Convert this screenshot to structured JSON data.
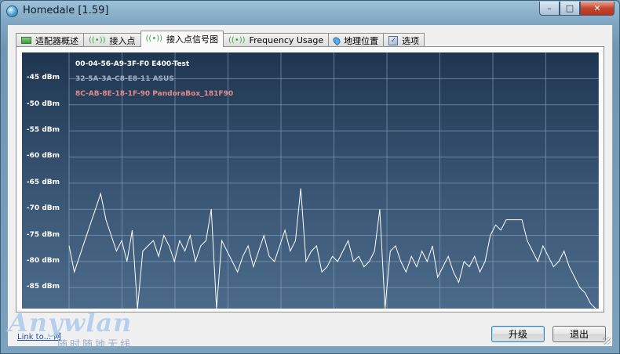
{
  "window": {
    "title": "Homedale [1.59]",
    "buttons": {
      "minimize": "–",
      "maximize": "□",
      "close": "✕"
    }
  },
  "tabs": [
    {
      "label": "适配器概述",
      "icon": "adapter-flag-icon"
    },
    {
      "label": "接入点",
      "icon": "wifi-signal-icon"
    },
    {
      "label": "接入点信号图",
      "icon": "wifi-signal-icon",
      "active": true
    },
    {
      "label": "Frequency Usage",
      "icon": "wifi-signal-icon"
    },
    {
      "label": "地理位置",
      "icon": "map-pin-icon"
    },
    {
      "label": "选项",
      "icon": "options-icon"
    }
  ],
  "legend": [
    {
      "text": "00-04-56-A9-3F-F0 E400-Test",
      "color": "#ffffff"
    },
    {
      "text": "32-5A-3A-C8-E8-11 ASUS",
      "color": "#9fb0c8"
    },
    {
      "text": "8C-AB-8E-18-1F-90 PandoraBox_181F90",
      "color": "#e08b8b"
    }
  ],
  "chart_data": {
    "type": "line",
    "yunit": "dBm",
    "ylim": [
      -89,
      -40
    ],
    "ytick_labels": [
      "-45 dBm",
      "-50 dBm",
      "-55 dBm",
      "-60 dBm",
      "-65 dBm",
      "-70 dBm",
      "-75 dBm",
      "-80 dBm",
      "-85 dBm"
    ],
    "yticks": [
      -45,
      -50,
      -55,
      -60,
      -65,
      -70,
      -75,
      -80,
      -85
    ],
    "grid": true,
    "xlim": [
      0,
      100
    ],
    "series": [
      {
        "name": "00-04-56-A9-3F-F0 E400-Test",
        "color": "#ffffff",
        "x": [
          0,
          1,
          2,
          3,
          4,
          5,
          6,
          7,
          8,
          9,
          10,
          11,
          12,
          13,
          14,
          15,
          16,
          17,
          18,
          19,
          20,
          21,
          22,
          23,
          24,
          25,
          26,
          27,
          28,
          29,
          30,
          31,
          32,
          33,
          34,
          35,
          36,
          37,
          38,
          39,
          40,
          41,
          42,
          43,
          44,
          45,
          46,
          47,
          48,
          49,
          50,
          51,
          52,
          53,
          54,
          55,
          56,
          57,
          58,
          59,
          60,
          61,
          62,
          63,
          64,
          65,
          66,
          67,
          68,
          69,
          70,
          71,
          72,
          73,
          74,
          75,
          76,
          77,
          78,
          79,
          80,
          81,
          82,
          83,
          84,
          85,
          86,
          87,
          88,
          89,
          90,
          91,
          92,
          93,
          94,
          95,
          96,
          97,
          98,
          99,
          100
        ],
        "y": [
          -77,
          -82,
          -79,
          -76,
          -73,
          -70,
          -67,
          -72,
          -75,
          -78,
          -76,
          -80,
          -74,
          -89,
          -78,
          -77,
          -76,
          -79,
          -75,
          -77,
          -80,
          -76,
          -78,
          -75,
          -80,
          -77,
          -76,
          -70,
          -89,
          -76,
          -78,
          -80,
          -82,
          -79,
          -77,
          -81,
          -78,
          -75,
          -79,
          -80,
          -77,
          -74,
          -78,
          -76,
          -66,
          -80,
          -78,
          -77,
          -82,
          -81,
          -79,
          -80,
          -78,
          -76,
          -80,
          -79,
          -81,
          -80,
          -78,
          -70,
          -89,
          -78,
          -77,
          -80,
          -82,
          -79,
          -81,
          -78,
          -80,
          -77,
          -83,
          -81,
          -79,
          -82,
          -84,
          -80,
          -81,
          -79,
          -82,
          -80,
          -75,
          -73,
          -74,
          -72,
          -72,
          -72,
          -72,
          -76,
          -78,
          -80,
          -77,
          -79,
          -81,
          -80,
          -78,
          -81,
          -83,
          -85,
          -86,
          -88,
          -89
        ]
      }
    ]
  },
  "footer": {
    "link": "Link to... 网",
    "upgrade_label": "升级",
    "exit_label": "退出"
  },
  "watermark": {
    "brand": "Anywlan",
    "sub": "随时随地无线"
  }
}
